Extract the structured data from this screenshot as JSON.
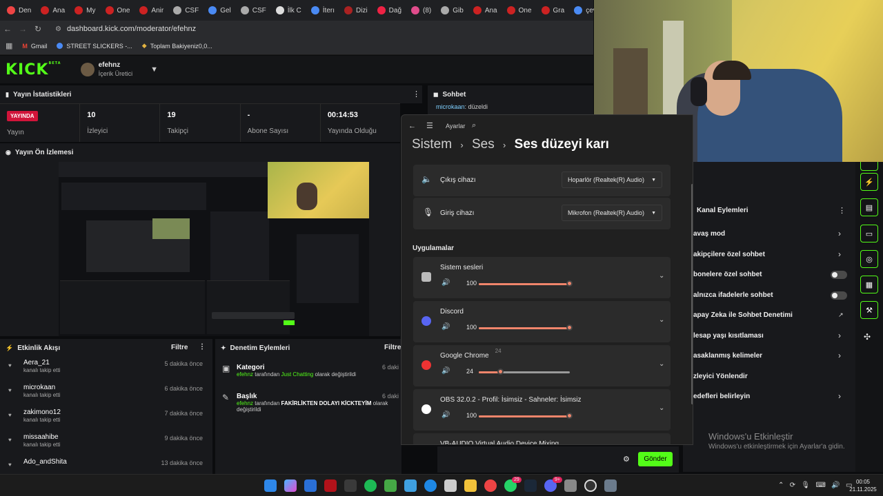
{
  "browser": {
    "tabs": [
      {
        "label": "Den",
        "color": "#ee4444"
      },
      {
        "label": "Ana",
        "color": "#cc2222"
      },
      {
        "label": "My",
        "color": "#cc2222"
      },
      {
        "label": "One",
        "color": "#cc2222"
      },
      {
        "label": "Anir",
        "color": "#cc2222"
      },
      {
        "label": "CSF",
        "color": "#aaaaaa"
      },
      {
        "label": "Gel",
        "color": "#4a8af4"
      },
      {
        "label": "CSF",
        "color": "#aaaaaa"
      },
      {
        "label": "İlk C",
        "color": "#dddddd"
      },
      {
        "label": "İterı",
        "color": "#4a8af4"
      },
      {
        "label": "Dizi",
        "color": "#aa2222"
      },
      {
        "label": "Dağ",
        "color": "#ee2244"
      },
      {
        "label": "(8)",
        "color": "#e14c8c"
      },
      {
        "label": "Gib",
        "color": "#aaaaaa"
      },
      {
        "label": "Ana",
        "color": "#cc2222"
      },
      {
        "label": "One",
        "color": "#cc2222"
      },
      {
        "label": "Gra",
        "color": "#cc2222"
      },
      {
        "label": "çev",
        "color": "#4a8af4"
      }
    ],
    "url": "dashboard.kick.com/moderator/efehnz",
    "bookmarks": [
      "Gmail",
      "STREET SLICKERS -...",
      "Toplam Bakiyeniz0,0..."
    ]
  },
  "kick": {
    "logo": "KICK",
    "beta": "BETA",
    "username": "efehnz",
    "role": "İçerik Üretici",
    "stats_title": "Yayın İstatistikleri",
    "stats": [
      {
        "value": "YAYINDA",
        "label": "Yayın"
      },
      {
        "value": "10",
        "label": "İzleyici"
      },
      {
        "value": "19",
        "label": "Takipçi"
      },
      {
        "value": "-",
        "label": "Abone Sayısı"
      },
      {
        "value": "00:14:53",
        "label": "Yayında Olduğu"
      }
    ],
    "preview_title": "Yayın Ön İzlemesi",
    "chat_title": "Sohbet",
    "chat_msg_user": "microkaan",
    "chat_msg_text": ": düzeldi",
    "feed_title": "Etkinlik Akışı",
    "feed_filter": "Filtre",
    "feed": [
      {
        "name": "Aera_21",
        "action": "kanalı takip etti",
        "time": "5 dakika önce"
      },
      {
        "name": "microkaan",
        "action": "kanalı takip etti",
        "time": "6 dakika önce"
      },
      {
        "name": "zakimono12",
        "action": "kanalı takip etti",
        "time": "7 dakika önce"
      },
      {
        "name": "missaahibe",
        "action": "kanalı takip etti",
        "time": "9 dakika önce"
      },
      {
        "name": "Ado_andShita",
        "action": "",
        "time": "13 dakika önce"
      }
    ],
    "mod_title": "Denetim Eylemleri",
    "mod_filter": "Filtre",
    "mod": [
      {
        "title": "Kategori",
        "user": "efehnz",
        "mid": "tarafından",
        "hl": "Just Chatting",
        "end": "olarak değiştirildi",
        "time": "6 daki"
      },
      {
        "title": "Başlık",
        "user": "efehnz",
        "mid": "tarafından",
        "hl": "FAKİRLİKTEN DOLAYI KİCKTEYİM",
        "end": "olarak değiştirildi",
        "time": "6 daki"
      }
    ],
    "channel_title": "Kanal Eylemleri",
    "channel_actions": [
      {
        "label": "avaş mod",
        "ctrl": "arrow"
      },
      {
        "label": "akipçilere özel sohbet",
        "ctrl": "arrow"
      },
      {
        "label": "bonelere özel sohbet",
        "ctrl": "toggle"
      },
      {
        "label": "alnızca ifadelerle sohbet",
        "ctrl": "toggle"
      },
      {
        "label": "apay Zeka ile Sohbet Denetimi",
        "ctrl": "ext"
      },
      {
        "label": "lesap yaşı kısıtlaması",
        "ctrl": "arrow"
      },
      {
        "label": "asaklanmış kelimeler",
        "ctrl": "arrow"
      },
      {
        "label": "zleyici Yönlendir",
        "ctrl": "none"
      },
      {
        "label": "edefleri belirleyin",
        "ctrl": "arrow"
      }
    ],
    "send_label": "Gönder"
  },
  "settings": {
    "app": "Ayarlar",
    "crumb": [
      "Sistem",
      "Ses",
      "Ses düzeyi karı"
    ],
    "tooltip_top": "67",
    "output_label": "Çıkış cihazı",
    "output_value": "Hoparlör (Realtek(R) Audio)",
    "input_label": "Giriş cihazı",
    "input_value": "Mikrofon (Realtek(R) Audio)",
    "apps_heading": "Uygulamalar",
    "apps": [
      {
        "name": "Sistem sesleri",
        "volume": "100",
        "level": 1.0
      },
      {
        "name": "Discord",
        "volume": "100",
        "level": 1.0
      },
      {
        "name": "Google Chrome",
        "volume": "24",
        "level": 0.24,
        "tooltip": "24"
      },
      {
        "name": "OBS 32.0.2 - Profil: İsimsiz - Sahneler: İsimsiz",
        "volume": "100",
        "level": 1.0
      },
      {
        "name": "VB-AUDIO Virtual Audio Device Mixing",
        "volume": "",
        "level": 0
      }
    ]
  },
  "windows": {
    "activate_title": "Windows'u Etkinleştir",
    "activate_sub": "Windows'u etkinleştirmek için Ayarlar'a gidin.",
    "time": "00:05",
    "date": "21.11.2025",
    "badge1": "29",
    "badge2": "9+"
  }
}
